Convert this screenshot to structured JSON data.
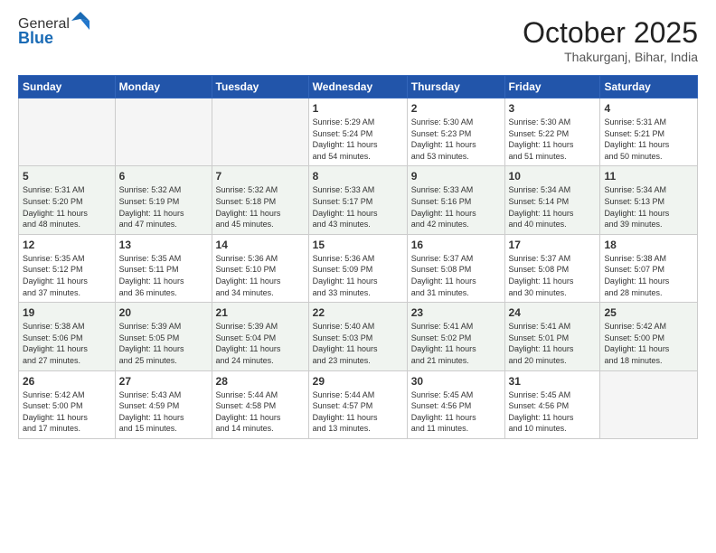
{
  "header": {
    "logo_line1": "General",
    "logo_line2": "Blue",
    "month": "October 2025",
    "location": "Thakurganj, Bihar, India"
  },
  "weekdays": [
    "Sunday",
    "Monday",
    "Tuesday",
    "Wednesday",
    "Thursday",
    "Friday",
    "Saturday"
  ],
  "weeks": [
    [
      {
        "day": "",
        "info": ""
      },
      {
        "day": "",
        "info": ""
      },
      {
        "day": "",
        "info": ""
      },
      {
        "day": "1",
        "info": "Sunrise: 5:29 AM\nSunset: 5:24 PM\nDaylight: 11 hours\nand 54 minutes."
      },
      {
        "day": "2",
        "info": "Sunrise: 5:30 AM\nSunset: 5:23 PM\nDaylight: 11 hours\nand 53 minutes."
      },
      {
        "day": "3",
        "info": "Sunrise: 5:30 AM\nSunset: 5:22 PM\nDaylight: 11 hours\nand 51 minutes."
      },
      {
        "day": "4",
        "info": "Sunrise: 5:31 AM\nSunset: 5:21 PM\nDaylight: 11 hours\nand 50 minutes."
      }
    ],
    [
      {
        "day": "5",
        "info": "Sunrise: 5:31 AM\nSunset: 5:20 PM\nDaylight: 11 hours\nand 48 minutes."
      },
      {
        "day": "6",
        "info": "Sunrise: 5:32 AM\nSunset: 5:19 PM\nDaylight: 11 hours\nand 47 minutes."
      },
      {
        "day": "7",
        "info": "Sunrise: 5:32 AM\nSunset: 5:18 PM\nDaylight: 11 hours\nand 45 minutes."
      },
      {
        "day": "8",
        "info": "Sunrise: 5:33 AM\nSunset: 5:17 PM\nDaylight: 11 hours\nand 43 minutes."
      },
      {
        "day": "9",
        "info": "Sunrise: 5:33 AM\nSunset: 5:16 PM\nDaylight: 11 hours\nand 42 minutes."
      },
      {
        "day": "10",
        "info": "Sunrise: 5:34 AM\nSunset: 5:14 PM\nDaylight: 11 hours\nand 40 minutes."
      },
      {
        "day": "11",
        "info": "Sunrise: 5:34 AM\nSunset: 5:13 PM\nDaylight: 11 hours\nand 39 minutes."
      }
    ],
    [
      {
        "day": "12",
        "info": "Sunrise: 5:35 AM\nSunset: 5:12 PM\nDaylight: 11 hours\nand 37 minutes."
      },
      {
        "day": "13",
        "info": "Sunrise: 5:35 AM\nSunset: 5:11 PM\nDaylight: 11 hours\nand 36 minutes."
      },
      {
        "day": "14",
        "info": "Sunrise: 5:36 AM\nSunset: 5:10 PM\nDaylight: 11 hours\nand 34 minutes."
      },
      {
        "day": "15",
        "info": "Sunrise: 5:36 AM\nSunset: 5:09 PM\nDaylight: 11 hours\nand 33 minutes."
      },
      {
        "day": "16",
        "info": "Sunrise: 5:37 AM\nSunset: 5:08 PM\nDaylight: 11 hours\nand 31 minutes."
      },
      {
        "day": "17",
        "info": "Sunrise: 5:37 AM\nSunset: 5:08 PM\nDaylight: 11 hours\nand 30 minutes."
      },
      {
        "day": "18",
        "info": "Sunrise: 5:38 AM\nSunset: 5:07 PM\nDaylight: 11 hours\nand 28 minutes."
      }
    ],
    [
      {
        "day": "19",
        "info": "Sunrise: 5:38 AM\nSunset: 5:06 PM\nDaylight: 11 hours\nand 27 minutes."
      },
      {
        "day": "20",
        "info": "Sunrise: 5:39 AM\nSunset: 5:05 PM\nDaylight: 11 hours\nand 25 minutes."
      },
      {
        "day": "21",
        "info": "Sunrise: 5:39 AM\nSunset: 5:04 PM\nDaylight: 11 hours\nand 24 minutes."
      },
      {
        "day": "22",
        "info": "Sunrise: 5:40 AM\nSunset: 5:03 PM\nDaylight: 11 hours\nand 23 minutes."
      },
      {
        "day": "23",
        "info": "Sunrise: 5:41 AM\nSunset: 5:02 PM\nDaylight: 11 hours\nand 21 minutes."
      },
      {
        "day": "24",
        "info": "Sunrise: 5:41 AM\nSunset: 5:01 PM\nDaylight: 11 hours\nand 20 minutes."
      },
      {
        "day": "25",
        "info": "Sunrise: 5:42 AM\nSunset: 5:00 PM\nDaylight: 11 hours\nand 18 minutes."
      }
    ],
    [
      {
        "day": "26",
        "info": "Sunrise: 5:42 AM\nSunset: 5:00 PM\nDaylight: 11 hours\nand 17 minutes."
      },
      {
        "day": "27",
        "info": "Sunrise: 5:43 AM\nSunset: 4:59 PM\nDaylight: 11 hours\nand 15 minutes."
      },
      {
        "day": "28",
        "info": "Sunrise: 5:44 AM\nSunset: 4:58 PM\nDaylight: 11 hours\nand 14 minutes."
      },
      {
        "day": "29",
        "info": "Sunrise: 5:44 AM\nSunset: 4:57 PM\nDaylight: 11 hours\nand 13 minutes."
      },
      {
        "day": "30",
        "info": "Sunrise: 5:45 AM\nSunset: 4:56 PM\nDaylight: 11 hours\nand 11 minutes."
      },
      {
        "day": "31",
        "info": "Sunrise: 5:45 AM\nSunset: 4:56 PM\nDaylight: 11 hours\nand 10 minutes."
      },
      {
        "day": "",
        "info": ""
      }
    ]
  ]
}
